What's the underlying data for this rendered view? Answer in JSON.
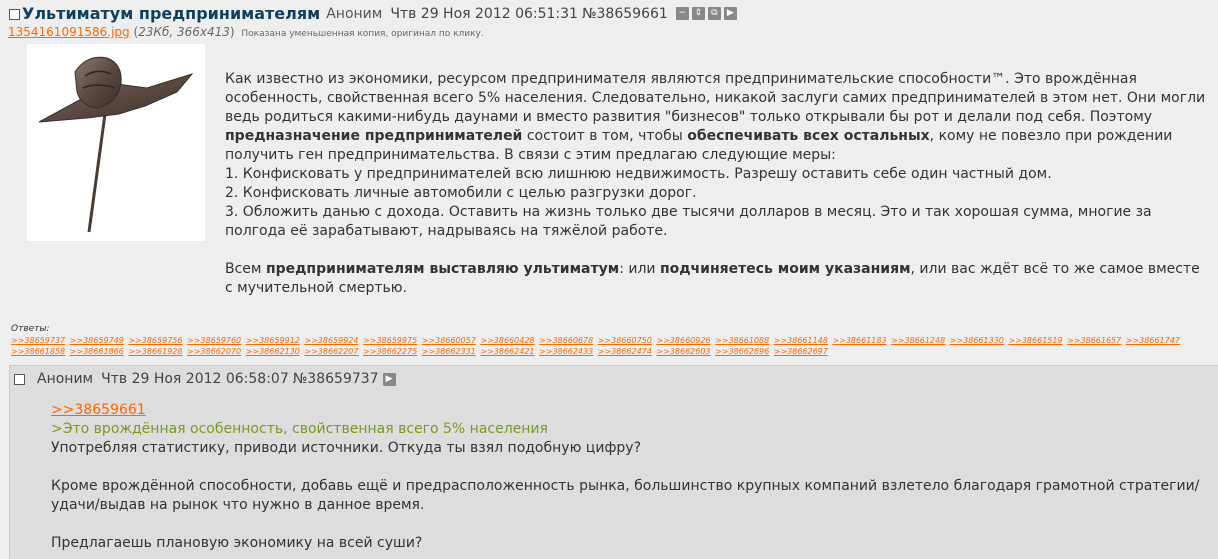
{
  "op": {
    "title": "Ультиматум предпринимателям",
    "name": "Аноним",
    "date": "Чтв 29 Ноя 2012 06:51:31",
    "number": "№38659661",
    "file": {
      "name": "1354161091586.jpg",
      "open": "(",
      "size": "23Кб, 366x413",
      "close": ")",
      "hint": "Показана уменьшенная копия, оригинал по клику."
    },
    "body": {
      "p1": "Как известно из экономики, ресурсом предпринимателя являются предпринимательские способности™. Это врождённая особенность, свойственная всего 5% населения. Следовательно, никакой заслуги самих предпринимателей в этом нет. Они могли ведь родиться какими-нибудь даунами и вместо развития \"бизнесов\" только открывали бы рот и делали под себя. Поэтому ",
      "b1": "предназначение предпринимателей",
      "p2": " состоит в том, чтобы ",
      "b2": "обеспечивать всех остальных",
      "p3": ", кому не повезло при рождении получить ген предпринимательства. В связи с этим предлагаю следующие меры:",
      "items": [
        "1. Конфисковать у предпринимателей всю лишнюю недвижимость. Разрешу оставить себе один частный дом.",
        "2. Конфисковать личные автомобили с целью разгрузки дорог.",
        "3. Обложить данью с дохода. Оставить на жизнь только две тысячи долларов в месяц. Это и так хорошая сумма, многие за полгода её зарабатывают, надрываясь на тяжёлой работе."
      ],
      "last_pre": "Всем ",
      "last_b1": "предпринимателям выставляю ультиматум",
      "last_mid": ": или ",
      "last_b2": "подчиняетесь моим указаниям",
      "last_post": ", или вас ждёт всё то же самое вместе с мучительной смертью."
    }
  },
  "replies": {
    "label": "Ответы:",
    "links": [
      ">>38659737",
      ">>38659749",
      ">>38659756",
      ">>38659760",
      ">>38659912",
      ">>38659924",
      ">>38659975",
      ">>38660057",
      ">>38660428",
      ">>38660678",
      ">>38660750",
      ">>38660926",
      ">>38661088",
      ">>38661148",
      ">>38661183",
      ">>38661248",
      ">>38661330",
      ">>38661519",
      ">>38661657",
      ">>38661747",
      ">>38661858",
      ">>38661866",
      ">>38661928",
      ">>38662070",
      ">>38662130",
      ">>38662207",
      ">>38662275",
      ">>38662331",
      ">>38662421",
      ">>38662433",
      ">>38662474",
      ">>38662603",
      ">>38662696",
      ">>38662697"
    ]
  },
  "reply": {
    "name": "Аноним",
    "date": "Чтв 29 Ноя 2012 06:58:07",
    "number": "№38659737",
    "ref": ">>38659661",
    "quote": ">Это врождённая особенность, свойственная всего 5% населения",
    "line1": "Употребляя статистику, приводи источники. Откуда ты взял подобную цифру?",
    "line2": "Кроме врождённой способности, добавь ещё и предрасположенность рынка, большинство крупных компаний взлетело благодаря грамотной стратегии/удачи/выдав на рынок что нужно в данное время.",
    "line3": "Предлагаешь плановую экономику на всей суши?"
  },
  "icons": {
    "hide": "−",
    "expand": "⇕",
    "fav": "⧉",
    "reply": "▶"
  },
  "colors": {
    "background": "#eeeeee",
    "reply_background": "#dddddd",
    "link": "#ff6600",
    "title": "#0f3f5e",
    "greentext": "#789922"
  }
}
